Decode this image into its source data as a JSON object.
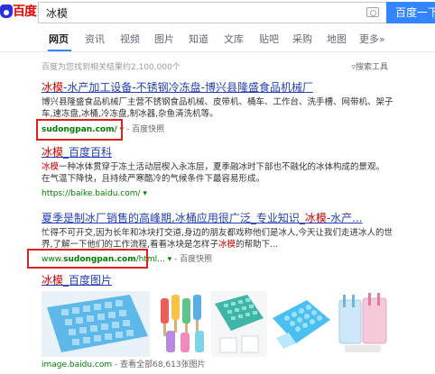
{
  "header": {
    "logo_text": "百度",
    "search_value": "冰模",
    "search_button": "百度一下"
  },
  "tabs": [
    {
      "label": "网页",
      "active": true
    },
    {
      "label": "资讯"
    },
    {
      "label": "视频"
    },
    {
      "label": "图片"
    },
    {
      "label": "知道"
    },
    {
      "label": "文库"
    },
    {
      "label": "贴吧"
    },
    {
      "label": "采购"
    },
    {
      "label": "地图"
    },
    {
      "label": "更多»"
    }
  ],
  "result_count": "百度为您找到相关结果约2,100,000个",
  "tools_label": "搜索工具",
  "results": [
    {
      "title_hl": "冰模",
      "title_rest": "-水产加工设备-不锈钢冷冻盘-博兴县隆盛食品机械厂",
      "desc_line1": "博兴县隆盛食品机械厂主营不锈钢食品机械、皮带机、桶车、工作台、洗手槽、网带机、架子",
      "desc_line2": "车,速冻盘,冰桶,冷冻盘,制冰器,杂鱼清洗机等。",
      "url": "sudongpan.com/",
      "kuaizhao": "百度快照"
    },
    {
      "title_hl": "冰模",
      "title_rest": "_百度百科",
      "desc_hl": "冰模",
      "desc_line1": "一种冰体贯穿于冻土活动层楔入永冻层，夏季融冰时下部也不融化的冰体构成的景观。",
      "desc_line2": "在气温下降快，且持续严寒酷冷的气候条件下最容易形成。",
      "url": "https://baike.baidu.com/"
    },
    {
      "title_pre": "夏季是制冰厂销售的高峰期,冰桶应用很广泛_专业知识_",
      "title_hl": "冰模",
      "title_rest": "-水产...",
      "desc_line1": "忙得不可开交,因为长年和冰块打交道,身边的朋友都戏称他们是冰人,今天让我们走进冰人的世",
      "desc_line2_pre": "界,了解一下他们的工作流程,看看冰块是怎样子",
      "desc_line2_hl": "冰模",
      "desc_line2_post": "的帮助下...",
      "url_pre": "www.",
      "url_bold": "sudongpan.com",
      "url_post": "/html...",
      "kuaizhao": "百度快照"
    },
    {
      "title_hl": "冰模",
      "title_rest": "_百度图片",
      "url": "image.baidu.com",
      "more_images": "查看全部68,613张图片"
    }
  ],
  "colors": {
    "link": "#2440b3",
    "highlight": "#cc0000",
    "url_green": "#008000",
    "baidu_blue": "#3385ff",
    "box_red": "#e0201b"
  }
}
